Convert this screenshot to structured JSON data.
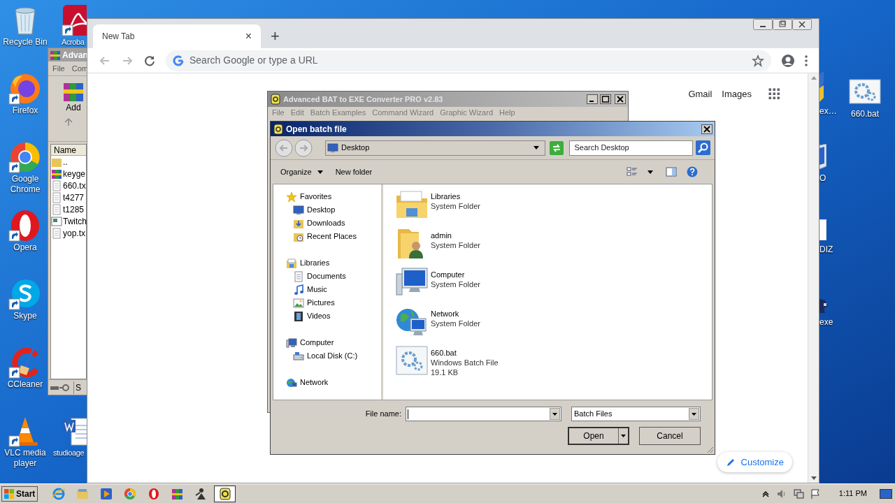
{
  "desktop_left": [
    {
      "label": "Recycle Bin",
      "kind": "trash",
      "shortcut": false
    },
    {
      "label": "Acroba",
      "kind": "pdf",
      "shortcut": true
    },
    {
      "label": "Firefox",
      "kind": "fox",
      "shortcut": true
    },
    {
      "label": "Google Chrome",
      "kind": "ring",
      "shortcut": true
    },
    {
      "label": "Opera",
      "kind": "opera",
      "shortcut": true
    },
    {
      "label": "Skype",
      "kind": "skype",
      "shortcut": true
    },
    {
      "label": "CCleaner",
      "kind": "ccleaner",
      "shortcut": true
    },
    {
      "label": "VLC media player",
      "kind": "cone",
      "shortcut": true
    },
    {
      "label": "studioage",
      "kind": "word",
      "shortcut": false
    }
  ],
  "desktop_right": [
    {
      "label": "ex…",
      "kind": "shield"
    },
    {
      "label": "660.bat",
      "kind": "gear_file"
    },
    {
      "label": "O",
      "kind": "monitor"
    },
    {
      "label": "DIZ",
      "kind": "page"
    },
    {
      "label": "exe",
      "kind": "figure"
    }
  ],
  "archiver": {
    "title": "Advan",
    "menu": [
      "File",
      "Com"
    ],
    "toolbar": [
      "Add"
    ],
    "column": "Name",
    "files": [
      {
        "name": "..",
        "kind": "folder"
      },
      {
        "name": "keyge",
        "kind": "archive"
      },
      {
        "name": "660.tx",
        "kind": "text"
      },
      {
        "name": "t4277",
        "kind": "text"
      },
      {
        "name": "t1285",
        "kind": "text"
      },
      {
        "name": "Twitch",
        "kind": "image"
      },
      {
        "name": "yop.tx",
        "kind": "text"
      }
    ],
    "status": "S"
  },
  "browser": {
    "tab": "New Tab",
    "tab_close": "×",
    "new_tab": "+",
    "omnibox_placeholder": "Search Google or type a URL",
    "links": [
      "Gmail",
      "Images"
    ],
    "customize": "Customize"
  },
  "app": {
    "title": "Advanced BAT to EXE Converter PRO v2.83",
    "menu": [
      "File",
      "Edit",
      "Batch Examples",
      "Command Wizard",
      "Graphic Wizard",
      "Help"
    ]
  },
  "dialog": {
    "title": "Open batch file",
    "location": "Desktop",
    "search": {
      "placeholder": "Search Desktop"
    },
    "commands": [
      "Organize",
      "New folder"
    ],
    "nav": [
      {
        "label": "Favorites",
        "kind": "star",
        "children": [
          {
            "label": "Desktop",
            "kind": "desktop"
          },
          {
            "label": "Downloads",
            "kind": "downloads"
          },
          {
            "label": "Recent Places",
            "kind": "recent"
          }
        ]
      },
      {
        "label": "Libraries",
        "kind": "library",
        "children": [
          {
            "label": "Documents",
            "kind": "doc"
          },
          {
            "label": "Music",
            "kind": "music"
          },
          {
            "label": "Pictures",
            "kind": "pictures"
          },
          {
            "label": "Videos",
            "kind": "videos"
          }
        ]
      },
      {
        "label": "Computer",
        "kind": "computer",
        "children": [
          {
            "label": "Local Disk (C:)",
            "kind": "disk"
          }
        ]
      },
      {
        "label": "Network",
        "kind": "network"
      }
    ],
    "items": [
      {
        "name": "Libraries",
        "type": "System Folder",
        "kind": "libraries"
      },
      {
        "name": "admin",
        "type": "System Folder",
        "kind": "user_folder"
      },
      {
        "name": "Computer",
        "type": "System Folder",
        "kind": "computer"
      },
      {
        "name": "Network",
        "type": "System Folder",
        "kind": "network"
      },
      {
        "name": "660.bat",
        "type": "Windows Batch File",
        "size": "19.1 KB",
        "kind": "batch"
      }
    ],
    "file_name_label": "File name:",
    "file_type": "Batch Files",
    "buttons": [
      "Open",
      "Cancel"
    ]
  },
  "taskbar": {
    "start": "Start",
    "apps": [
      {
        "kind": "ie",
        "selected": false
      },
      {
        "kind": "folder",
        "selected": false
      },
      {
        "kind": "media",
        "selected": false
      },
      {
        "kind": "ring",
        "selected": false
      },
      {
        "kind": "opera",
        "selected": false
      },
      {
        "kind": "archive",
        "selected": false
      },
      {
        "kind": "figure",
        "selected": false
      },
      {
        "kind": "batconv",
        "selected": true
      }
    ],
    "clock": "1:11 PM"
  }
}
